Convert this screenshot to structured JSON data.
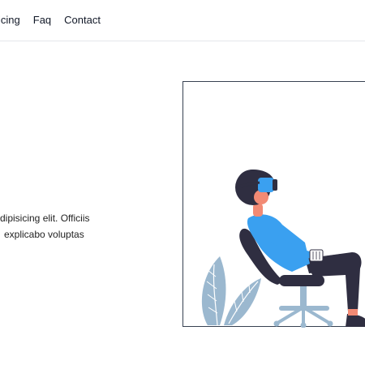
{
  "nav": {
    "items": [
      {
        "label": "icing"
      },
      {
        "label": "Faq"
      },
      {
        "label": "Contact"
      }
    ]
  },
  "hero": {
    "line1": "dipisicing elit. Officiis",
    "line2": "explicabo voluptas"
  },
  "colors": {
    "accent": "#3aa0f0",
    "plant": "#9bb8cf",
    "dark": "#2f2e41"
  }
}
